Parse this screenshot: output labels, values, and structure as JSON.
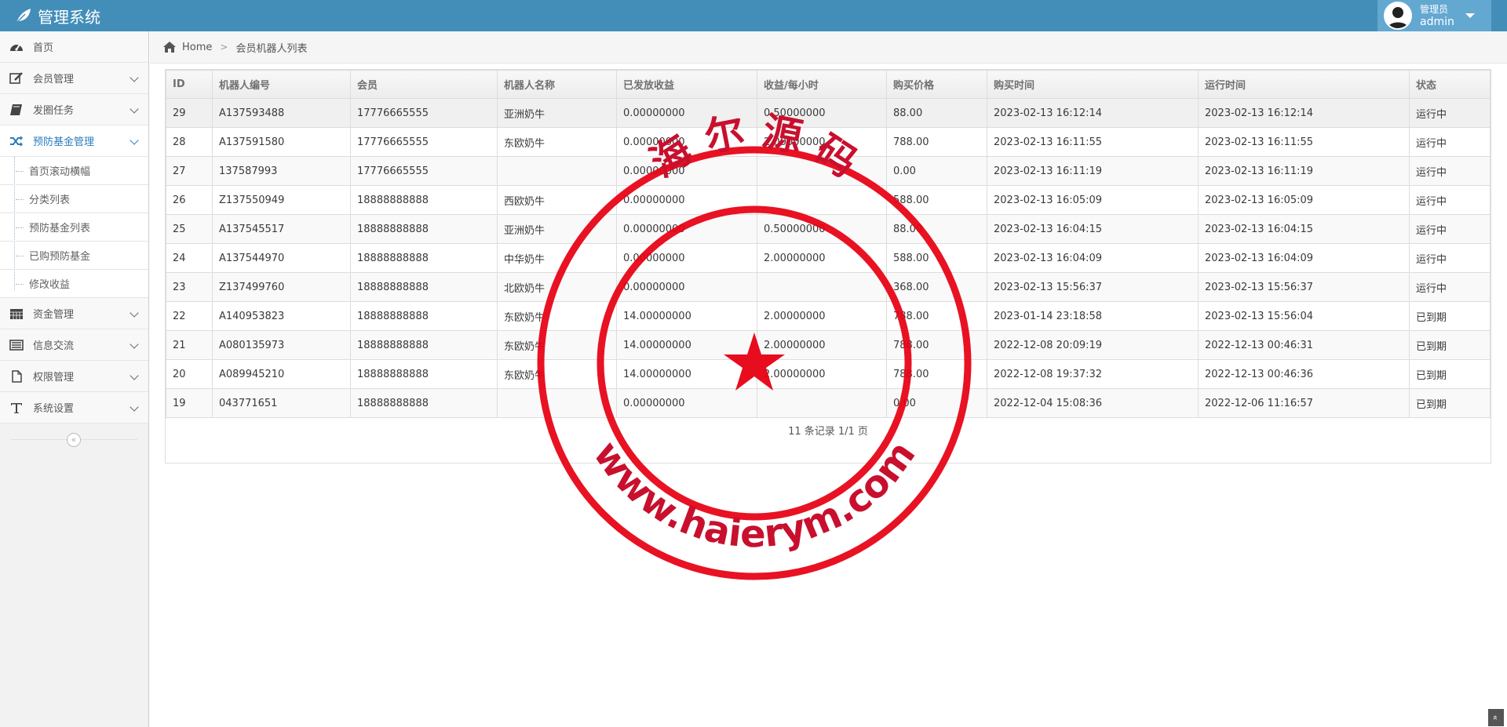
{
  "app": {
    "title": "管理系统"
  },
  "user": {
    "role": "管理员",
    "name": "admin"
  },
  "sidebar": {
    "items": [
      {
        "label": "首页",
        "icon": "dashboard-icon"
      },
      {
        "label": "会员管理",
        "icon": "edit-icon"
      },
      {
        "label": "发圈任务",
        "icon": "book-icon"
      },
      {
        "label": "预防基金管理",
        "icon": "random-icon",
        "active": true
      }
    ],
    "sub_items": [
      "首页滚动横幅",
      "分类列表",
      "预防基金列表",
      "已购预防基金",
      "修改收益"
    ],
    "items_after": [
      {
        "label": "资金管理",
        "icon": "calendar-icon"
      },
      {
        "label": "信息交流",
        "icon": "list-icon"
      },
      {
        "label": "权限管理",
        "icon": "file-icon"
      },
      {
        "label": "系统设置",
        "icon": "text-icon"
      }
    ],
    "collapse_glyph": "«"
  },
  "breadcrumb": {
    "home": "Home",
    "current": "会员机器人列表"
  },
  "table": {
    "headers": [
      "ID",
      "机器人编号",
      "会员",
      "机器人名称",
      "已发放收益",
      "收益/每小时",
      "购买价格",
      "购买时间",
      "运行时间",
      "状态"
    ],
    "rows": [
      [
        "29",
        "A137593488",
        "17776665555",
        "亚洲奶牛",
        "0.00000000",
        "0.50000000",
        "88.00",
        "2023-02-13 16:12:14",
        "2023-02-13 16:12:14",
        "运行中"
      ],
      [
        "28",
        "A137591580",
        "17776665555",
        "东欧奶牛",
        "0.00000000",
        "2.00000000",
        "788.00",
        "2023-02-13 16:11:55",
        "2023-02-13 16:11:55",
        "运行中"
      ],
      [
        "27",
        "137587993",
        "17776665555",
        "",
        "0.00000000",
        "",
        "0.00",
        "2023-02-13 16:11:19",
        "2023-02-13 16:11:19",
        "运行中"
      ],
      [
        "26",
        "Z137550949",
        "18888888888",
        "西欧奶牛",
        "0.00000000",
        "",
        "588.00",
        "2023-02-13 16:05:09",
        "2023-02-13 16:05:09",
        "运行中"
      ],
      [
        "25",
        "A137545517",
        "18888888888",
        "亚洲奶牛",
        "0.00000000",
        "0.50000000",
        "88.00",
        "2023-02-13 16:04:15",
        "2023-02-13 16:04:15",
        "运行中"
      ],
      [
        "24",
        "A137544970",
        "18888888888",
        "中华奶牛",
        "0.00000000",
        "2.00000000",
        "588.00",
        "2023-02-13 16:04:09",
        "2023-02-13 16:04:09",
        "运行中"
      ],
      [
        "23",
        "Z137499760",
        "18888888888",
        "北欧奶牛",
        "0.00000000",
        "",
        "368.00",
        "2023-02-13 15:56:37",
        "2023-02-13 15:56:37",
        "运行中"
      ],
      [
        "22",
        "A140953823",
        "18888888888",
        "东欧奶牛",
        "14.00000000",
        "2.00000000",
        "788.00",
        "2023-01-14 23:18:58",
        "2023-02-13 15:56:04",
        "已到期"
      ],
      [
        "21",
        "A080135973",
        "18888888888",
        "东欧奶牛",
        "14.00000000",
        "2.00000000",
        "788.00",
        "2022-12-08 20:09:19",
        "2022-12-13 00:46:31",
        "已到期"
      ],
      [
        "20",
        "A089945210",
        "18888888888",
        "东欧奶牛",
        "14.00000000",
        "2.00000000",
        "788.00",
        "2022-12-08 19:37:32",
        "2022-12-13 00:46:36",
        "已到期"
      ],
      [
        "19",
        "043771651",
        "18888888888",
        "",
        "0.00000000",
        "",
        "0.00",
        "2022-12-04 15:08:36",
        "2022-12-06 11:16:57",
        "已到期"
      ]
    ],
    "pager": "11 条记录 1/1 页"
  },
  "stamp": {
    "top_text": "海 尔 源 码",
    "bottom_text": "www.haierym.com",
    "color": "#e60012"
  },
  "colors": {
    "navbar": "#438eb9",
    "user_box": "#62a8d1",
    "active": "#2b7dbc"
  },
  "scroll_top_glyph": "»"
}
